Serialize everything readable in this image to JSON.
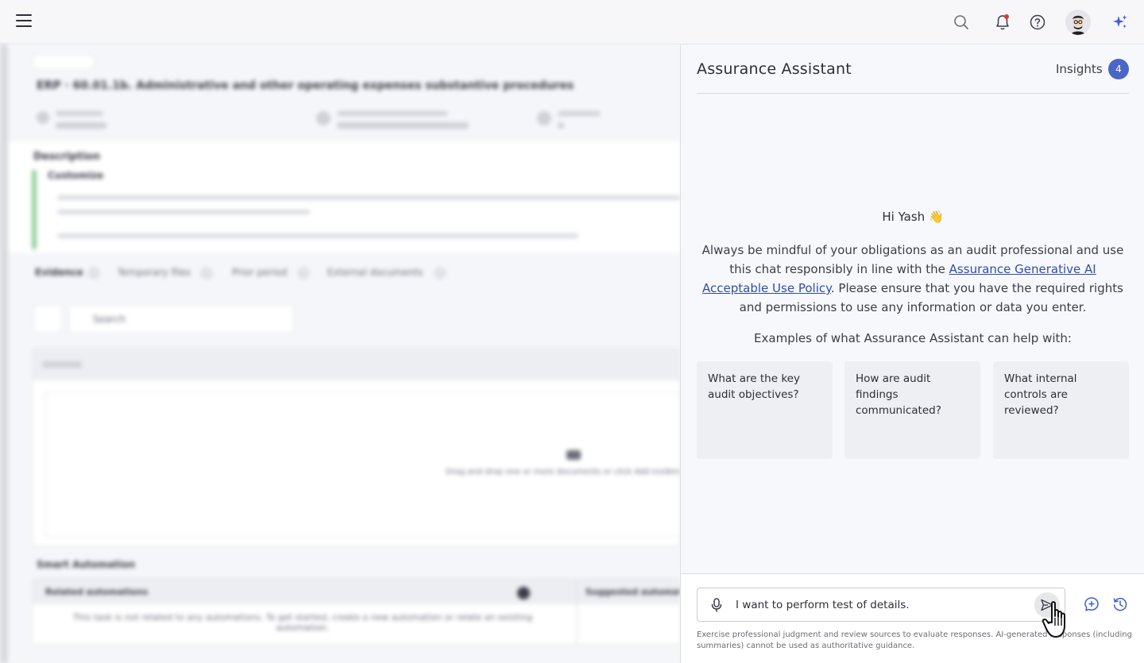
{
  "panel": {
    "title": "Assurance Assistant",
    "insights_label": "Insights",
    "insights_count": "4"
  },
  "welcome": {
    "greeting": "Hi Yash 👋",
    "disclaimer_pre": "Always be mindful of your obligations as an audit professional and use this chat responsibly in line with the ",
    "policy_link": "Assurance Generative AI Acceptable Use Policy",
    "disclaimer_post": ". Please ensure that you have the required rights and permissions to use any information or data you enter.",
    "examples_label": "Examples of what Assurance Assistant can help with:"
  },
  "examples": [
    "What are the key audit objectives?",
    "How are audit findings communicated?",
    "What internal controls are reviewed?"
  ],
  "composer": {
    "value": "I want to perform test of details.",
    "footnote": "Exercise professional judgment and review sources to evaluate responses. AI-generated responses (including summaries) cannot be used as authoritative guidance."
  },
  "background": {
    "title": "ERP · 60.01.1b. Administrative and other operating expenses substantive procedures",
    "description_label": "Description",
    "customize": "Customize",
    "tabs": [
      "Evidence",
      "Temporary files",
      "Prior period",
      "External documents"
    ],
    "search_placeholder": "Search",
    "drop_hint": "Drag and drop one or more documents or click Add evidence",
    "smart_automation": "Smart Automation",
    "related_automations": "Related automations",
    "suggested_automations": "Suggested automations",
    "automation_empty": "This task is not related to any automations. To get started, create a new automation or relate an existing automation."
  },
  "colors": {
    "accent": "#4a66c6",
    "link": "#2f4ea8",
    "sparkle": "#3f5fd1"
  }
}
